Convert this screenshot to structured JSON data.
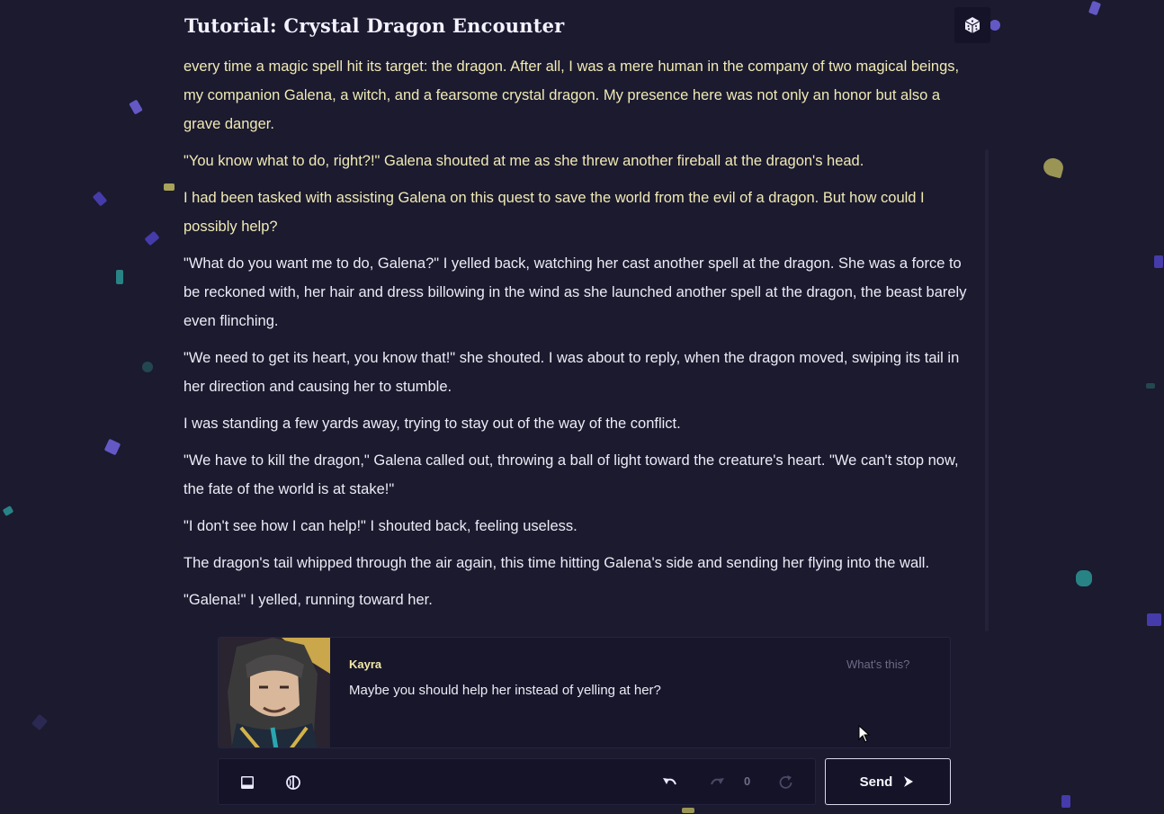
{
  "header": {
    "title": "Tutorial: Crystal Dragon Encounter",
    "dice_icon": "dice-icon"
  },
  "story": {
    "paragraphs": [
      "every time a magic spell hit its target: the dragon. After all, I was a mere human in the company of two magical beings, my companion Galena, a witch, and a fearsome crystal dragon. My presence here was not only an honor but also a grave danger.",
      "\"You know what to do, right?!\" Galena shouted at me as she threw another fireball at the dragon's head.",
      "I had been tasked with assisting Galena on this quest to save the world from the evil of a dragon. But how could I possibly help?",
      "\"What do you want me to do, Galena?\" I yelled back, watching her cast another spell at the dragon. She was a force to be reckoned with, her hair and dress billowing in the wind as she launched another spell at the dragon, the beast barely even flinching.",
      "\"We need to get its heart, you know that!\" she shouted. I was about to reply, when the dragon moved, swiping its tail in her direction and causing her to stumble.",
      "I was standing a few yards away, trying to stay out of the way of the conflict.",
      "\"We have to kill the dragon,\" Galena called out, throwing a ball of light toward the creature's heart. \"We can't stop now, the fate of the world is at stake!\"",
      "\"I don't see how I can help!\" I shouted back, feeling useless.",
      "The dragon's tail whipped through the air again, this time hitting Galena's side and sending her flying into the wall.",
      "\"Galena!\" I yelled, running toward her."
    ]
  },
  "suggestion": {
    "name": "Kayra",
    "text": "Maybe you should help her instead of yelling at her?",
    "whats_this": "What's this?"
  },
  "toolbar": {
    "undo_count": "0"
  },
  "send": {
    "label": "Send"
  },
  "colors": {
    "background": "#1b1a2f",
    "panel": "#141327",
    "highlight_text": "#f1eab4",
    "name_accent": "#f3e9a6"
  }
}
